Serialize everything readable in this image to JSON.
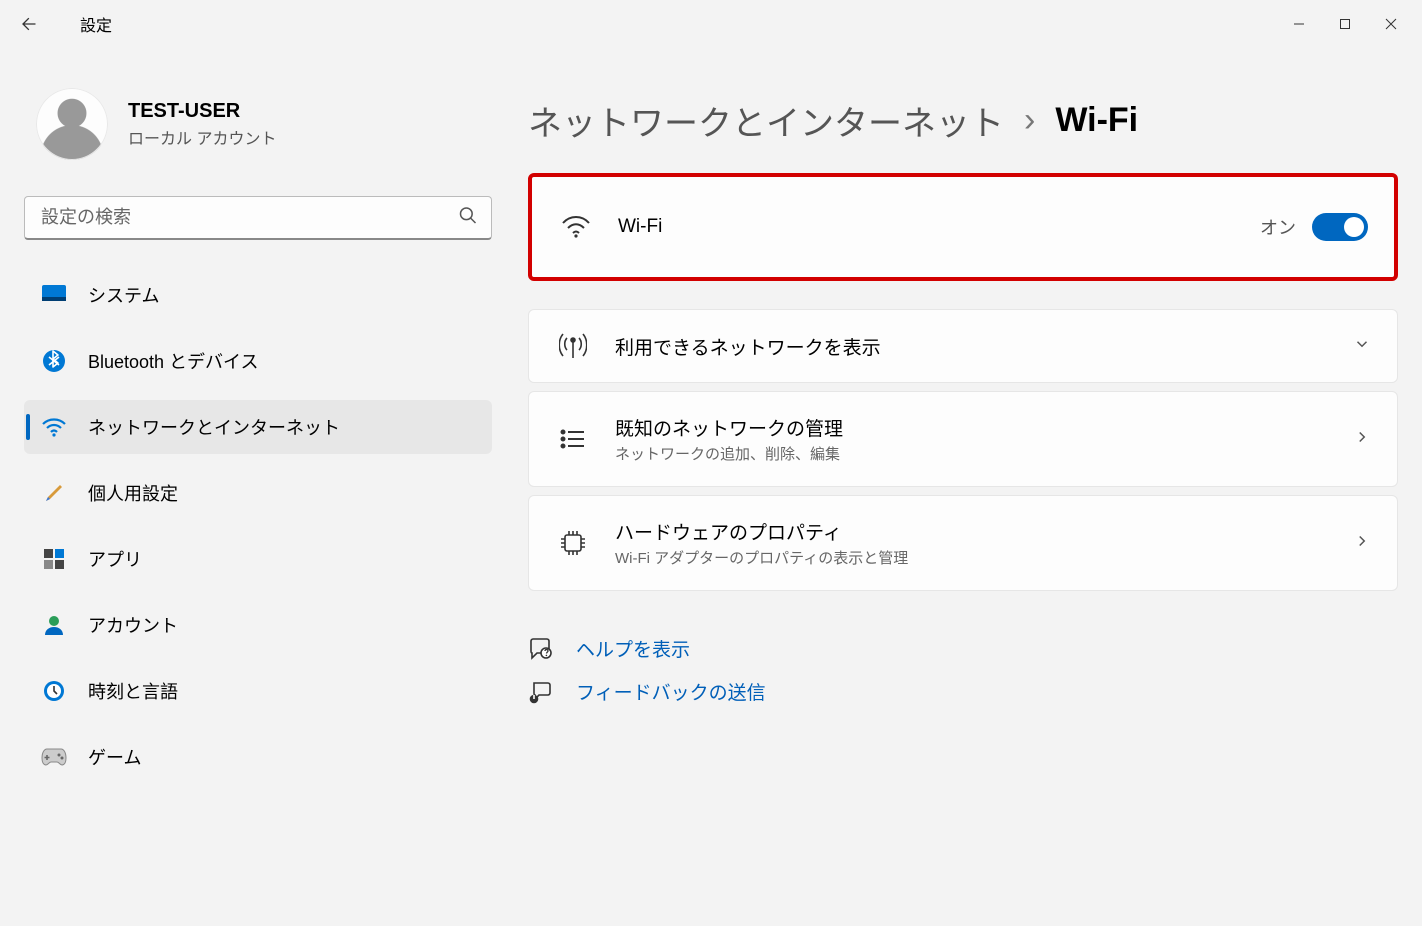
{
  "window": {
    "app_title": "設定"
  },
  "user": {
    "name": "TEST-USER",
    "subtitle": "ローカル アカウント"
  },
  "search": {
    "placeholder": "設定の検索"
  },
  "nav": {
    "items": [
      {
        "key": "system",
        "label": "システム"
      },
      {
        "key": "bluetooth",
        "label": "Bluetooth とデバイス"
      },
      {
        "key": "network",
        "label": "ネットワークとインターネット"
      },
      {
        "key": "personalize",
        "label": "個人用設定"
      },
      {
        "key": "apps",
        "label": "アプリ"
      },
      {
        "key": "accounts",
        "label": "アカウント"
      },
      {
        "key": "time",
        "label": "時刻と言語"
      },
      {
        "key": "gaming",
        "label": "ゲーム"
      }
    ],
    "active_key": "network"
  },
  "breadcrumb": {
    "parent": "ネットワークとインターネット",
    "sep": "›",
    "current": "Wi-Fi"
  },
  "main": {
    "wifi": {
      "title": "Wi-Fi",
      "state_label": "オン",
      "enabled": true
    },
    "available": {
      "title": "利用できるネットワークを表示"
    },
    "known": {
      "title": "既知のネットワークの管理",
      "subtitle": "ネットワークの追加、削除、編集"
    },
    "hardware": {
      "title": "ハードウェアのプロパティ",
      "subtitle": "Wi-Fi アダプターのプロパティの表示と管理"
    }
  },
  "links": {
    "help": "ヘルプを表示",
    "feedback": "フィードバックの送信"
  },
  "colors": {
    "accent": "#0067c0",
    "highlight_border": "#d20000"
  }
}
